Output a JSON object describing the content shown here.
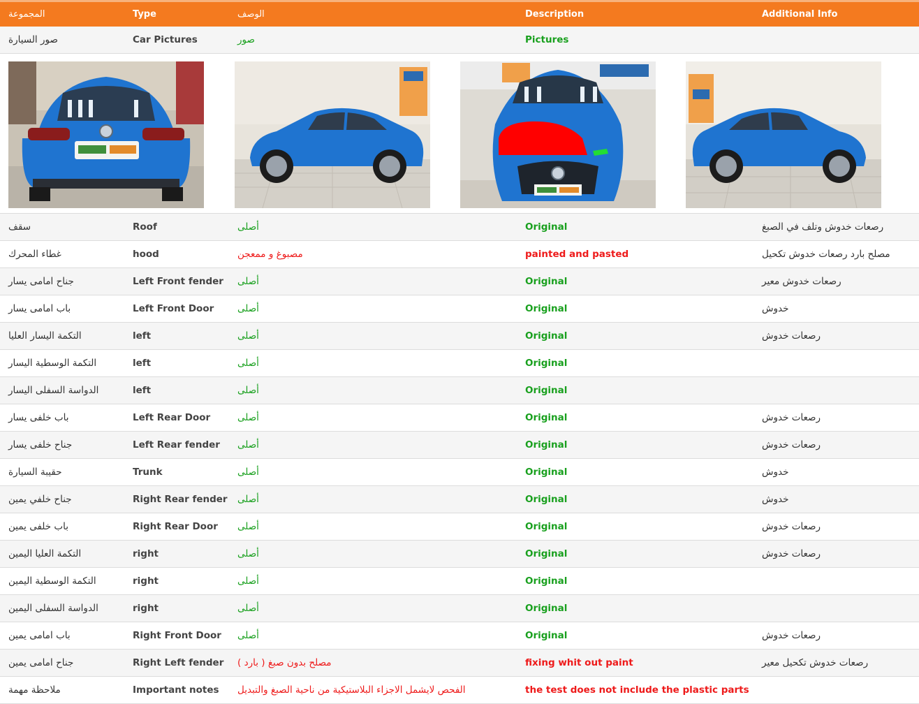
{
  "colors": {
    "header": "#f47a1f",
    "green": "#19a01e",
    "red": "#ee1a1a",
    "car": "#1f74d0"
  },
  "header": {
    "group_ar": "المجموعة",
    "type": "Type",
    "desc_ar": "الوصف",
    "description": "Description",
    "additional": "Additional Info"
  },
  "pictures_row": {
    "group": "صور السيارة",
    "type": "Car Pictures",
    "desc_ar": "صور",
    "description": "Pictures"
  },
  "photos": [
    {
      "view": "rear",
      "name": "car-rear-photo"
    },
    {
      "view": "left-side",
      "name": "car-left-side-photo"
    },
    {
      "view": "front",
      "name": "car-front-photo"
    },
    {
      "view": "right-side",
      "name": "car-right-side-photo"
    }
  ],
  "rows": [
    {
      "group": "سقف",
      "type": "Roof",
      "desc_ar": "أصلى",
      "description": "Original",
      "additional": "رصعات خدوش وتلف في الصبغ",
      "status": "green"
    },
    {
      "group": "غطاء المحرك",
      "type": "hood",
      "desc_ar": "مصبوغ و ممعجن",
      "description": "painted and pasted",
      "additional": "مصلح بارد رصعات خدوش تكحيل",
      "status": "red"
    },
    {
      "group": "جناح امامى يسار",
      "type": "Left Front fender",
      "desc_ar": "أصلى",
      "description": "Original",
      "additional": "رصعات خدوش معير",
      "status": "green"
    },
    {
      "group": "باب امامى يسار",
      "type": "Left Front Door",
      "desc_ar": "أصلى",
      "description": "Original",
      "additional": "خدوش",
      "status": "green"
    },
    {
      "group": "التكمة اليسار العليا",
      "type": "left",
      "desc_ar": "أصلى",
      "description": "Original",
      "additional": "رصعات خدوش",
      "status": "green"
    },
    {
      "group": "التكمة الوسطية اليسار",
      "type": "left",
      "desc_ar": "أصلى",
      "description": "Original",
      "additional": "",
      "status": "green"
    },
    {
      "group": "الدواسة السفلى اليسار",
      "type": "left",
      "desc_ar": "أصلى",
      "description": "Original",
      "additional": "",
      "status": "green"
    },
    {
      "group": "باب خلفى يسار",
      "type": "Left Rear Door",
      "desc_ar": "أصلى",
      "description": "Original",
      "additional": "رصعات خدوش",
      "status": "green"
    },
    {
      "group": "جناح خلفى يسار",
      "type": "Left Rear fender",
      "desc_ar": "أصلى",
      "description": "Original",
      "additional": "رصعات خدوش",
      "status": "green"
    },
    {
      "group": "حقيبة السيارة",
      "type": "Trunk",
      "desc_ar": "أصلى",
      "description": "Original",
      "additional": "خدوش",
      "status": "green"
    },
    {
      "group": "جناح خلفي يمين",
      "type": "Right Rear fender",
      "desc_ar": "أصلى",
      "description": "Original",
      "additional": "خدوش",
      "status": "green"
    },
    {
      "group": "باب خلفى يمين",
      "type": "Right Rear Door",
      "desc_ar": "أصلى",
      "description": "Original",
      "additional": "رصعات خدوش",
      "status": "green"
    },
    {
      "group": "التكمة العليا اليمين",
      "type": "right",
      "desc_ar": "أصلى",
      "description": "Original",
      "additional": "رصعات خدوش",
      "status": "green"
    },
    {
      "group": "التكمة الوسطية اليمين",
      "type": "right",
      "desc_ar": "أصلى",
      "description": "Original",
      "additional": "",
      "status": "green"
    },
    {
      "group": "الدواسة السفلى اليمين",
      "type": "right",
      "desc_ar": "أصلى",
      "description": "Original",
      "additional": "",
      "status": "green"
    },
    {
      "group": "باب امامى يمين",
      "type": "Right Front Door",
      "desc_ar": "أصلى",
      "description": "Original",
      "additional": "رصعات خدوش",
      "status": "green"
    },
    {
      "group": "جناح امامى يمين",
      "type": "Right Left fender",
      "desc_ar": "( مصلح بدون صبغ ( بارد",
      "description": "fixing whit out paint",
      "additional": "رصعات خدوش تكحيل معير",
      "status": "red"
    },
    {
      "group": "ملاحظة مهمة",
      "type": "Important notes",
      "desc_ar": "الفحص لايشمل الاجزاء البلاستيكية من ناحية الصبغ والتبديل",
      "description": "the test does not include the plastic parts",
      "additional": "",
      "status": "red"
    }
  ]
}
